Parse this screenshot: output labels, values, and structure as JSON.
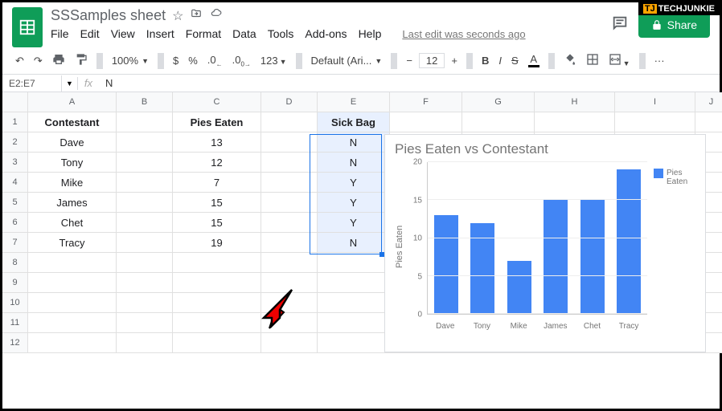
{
  "watermark": {
    "prefix": "TJ",
    "brand": "TECHJUNKIE"
  },
  "doc": {
    "title": "SSSamples sheet"
  },
  "menu": {
    "file": "File",
    "edit": "Edit",
    "view": "View",
    "insert": "Insert",
    "format": "Format",
    "data": "Data",
    "tools": "Tools",
    "addons": "Add-ons",
    "help": "Help",
    "last_edit": "Last edit was seconds ago"
  },
  "share": {
    "label": "Share"
  },
  "toolbar": {
    "zoom": "100%",
    "currency": "$",
    "percent": "%",
    "dec_dec": ".0",
    "dec_inc": ".00",
    "num_fmt": "123",
    "font": "Default (Ari...",
    "font_size": "12",
    "more": "···"
  },
  "name_box": "E2:E7",
  "fx": "fx",
  "fx_value": "N",
  "cols": [
    "A",
    "B",
    "C",
    "D",
    "E",
    "F",
    "G",
    "H",
    "I",
    "J"
  ],
  "rows": [
    "1",
    "2",
    "3",
    "4",
    "5",
    "6",
    "7",
    "8",
    "9",
    "10",
    "11",
    "12"
  ],
  "headers": {
    "A": "Contestant",
    "C": "Pies Eaten",
    "E": "Sick Bag"
  },
  "data": {
    "contestants": [
      "Dave",
      "Tony",
      "Mike",
      "James",
      "Chet",
      "Tracy"
    ],
    "pies": [
      "13",
      "12",
      "7",
      "15",
      "15",
      "19"
    ],
    "sick": [
      "N",
      "N",
      "Y",
      "Y",
      "Y",
      "N"
    ]
  },
  "chart_data": {
    "type": "bar",
    "title": "Pies Eaten vs Contestant",
    "ylabel": "Pies Eaten",
    "legend": "Pies Eaten",
    "ylim": [
      0,
      20
    ],
    "yticks": [
      0,
      5,
      10,
      15,
      20
    ],
    "categories": [
      "Dave",
      "Tony",
      "Mike",
      "James",
      "Chet",
      "Tracy"
    ],
    "values": [
      13,
      12,
      7,
      15,
      15,
      19
    ]
  }
}
